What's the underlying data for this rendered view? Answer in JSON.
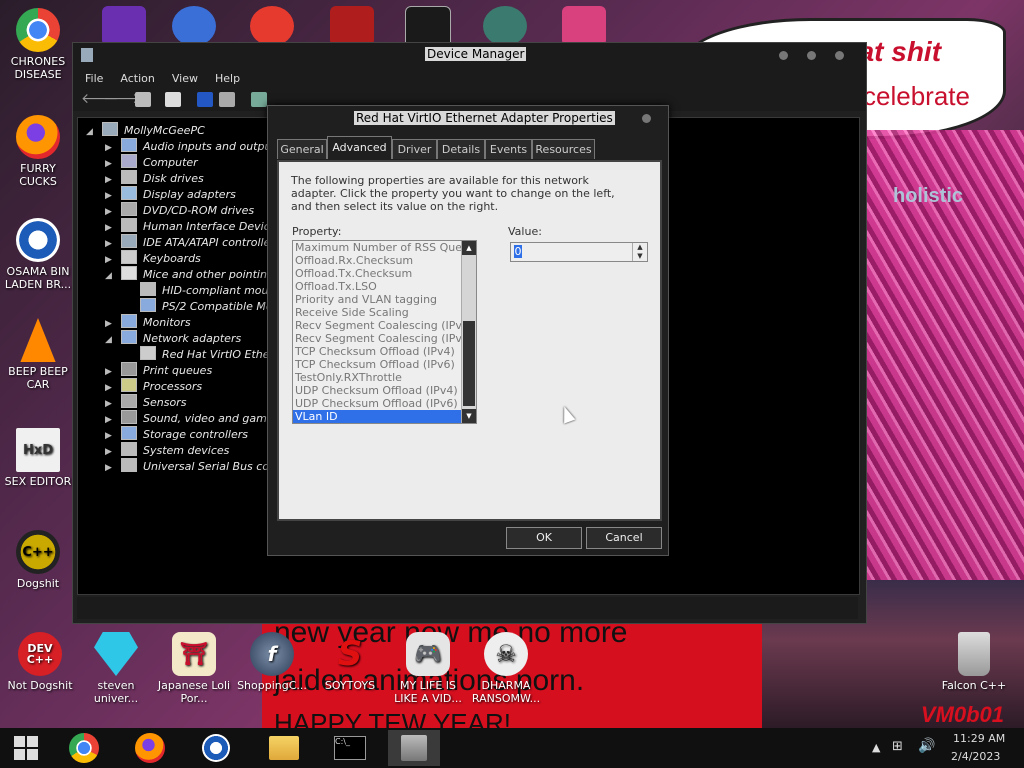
{
  "wallpaper": {
    "top_text_1": "eat shit",
    "top_text_2": "celebrate",
    "mid_text": "holistic",
    "red_lines": [
      "new year new me no more",
      "jaiden animations porn.",
      "HAPPY TEW YEAR!"
    ],
    "corner_tag": "VM0b01"
  },
  "desktop_icons": [
    {
      "label": "CHRONES DISEASE",
      "icon": "chrome-icon"
    },
    {
      "label": "FURRY CUCKS",
      "icon": "firefox-icon"
    },
    {
      "label": "OSAMA BIN LADEN BR...",
      "icon": "obama-logo-icon"
    },
    {
      "label": "BEEP BEEP CAR",
      "icon": "vlc-cone-icon"
    },
    {
      "label": "SEX EDITOR",
      "icon": "hxd-icon"
    },
    {
      "label": "Dogshit",
      "icon": "dogshit-icon"
    },
    {
      "label": "Not Dogshit",
      "icon": "devcpp-icon"
    },
    {
      "label": "steven univer...",
      "icon": "diamond-icon"
    },
    {
      "label": "Japanese Loli Por...",
      "icon": "torii-icon"
    },
    {
      "label": "ShoppingC...",
      "icon": "flash-icon"
    },
    {
      "label": "SOYTOYS",
      "icon": "soytoys-icon"
    },
    {
      "label": "MY LIFE IS LIKE A VID...",
      "icon": "gamepad-icon"
    },
    {
      "label": "DHARMA RANSOMW...",
      "icon": "skull-icon"
    },
    {
      "label": "Falcon C++",
      "icon": "trash-icon"
    }
  ],
  "device_manager": {
    "title": "Device Manager",
    "menu": [
      "File",
      "Action",
      "View",
      "Help"
    ],
    "tree": [
      {
        "label": "MollyMcGeePC",
        "level": 0,
        "expanded": true
      },
      {
        "label": "Audio inputs and outputs",
        "level": 1
      },
      {
        "label": "Computer",
        "level": 1
      },
      {
        "label": "Disk drives",
        "level": 1
      },
      {
        "label": "Display adapters",
        "level": 1
      },
      {
        "label": "DVD/CD-ROM drives",
        "level": 1
      },
      {
        "label": "Human Interface Devices",
        "level": 1
      },
      {
        "label": "IDE ATA/ATAPI controller:",
        "level": 1
      },
      {
        "label": "Keyboards",
        "level": 1
      },
      {
        "label": "Mice and other pointing de",
        "level": 1,
        "expanded": true
      },
      {
        "label": "HID-compliant mouse",
        "level": 2
      },
      {
        "label": "PS/2 Compatible Mou",
        "level": 2
      },
      {
        "label": "Monitors",
        "level": 1
      },
      {
        "label": "Network adapters",
        "level": 1,
        "expanded": true
      },
      {
        "label": "Red Hat VirtIO Ethern",
        "level": 2
      },
      {
        "label": "Print queues",
        "level": 1
      },
      {
        "label": "Processors",
        "level": 1
      },
      {
        "label": "Sensors",
        "level": 1
      },
      {
        "label": "Sound, video and game co",
        "level": 1
      },
      {
        "label": "Storage controllers",
        "level": 1
      },
      {
        "label": "System devices",
        "level": 1
      },
      {
        "label": "Universal Serial Bus contr",
        "level": 1
      }
    ]
  },
  "properties_dialog": {
    "title": "Red Hat VirtIO Ethernet Adapter Properties",
    "tabs": [
      "General",
      "Advanced",
      "Driver",
      "Details",
      "Events",
      "Resources"
    ],
    "active_tab": "Advanced",
    "description": "The following properties are available for this network adapter. Click the property you want to change on the left, and then select its value on the right.",
    "property_label": "Property:",
    "value_label": "Value:",
    "properties": [
      "Maximum Number of RSS Queues",
      "Offload.Rx.Checksum",
      "Offload.Tx.Checksum",
      "Offload.Tx.LSO",
      "Priority and VLAN tagging",
      "Receive Side Scaling",
      "Recv Segment Coalescing (IPv4)",
      "Recv Segment Coalescing (IPv6)",
      "TCP Checksum Offload (IPv4)",
      "TCP Checksum Offload (IPv6)",
      "TestOnly.RXThrottle",
      "UDP Checksum Offload (IPv4)",
      "UDP Checksum Offload (IPv6)",
      "VLan ID"
    ],
    "selected_property": "VLan ID",
    "value": "0",
    "ok_label": "OK",
    "cancel_label": "Cancel"
  },
  "taskbar": {
    "apps": [
      "start-icon",
      "chrome-icon",
      "firefox-icon",
      "obama-logo-icon",
      "file-explorer-icon",
      "cmd-icon",
      "device-manager-icon"
    ],
    "time": "11:29 AM",
    "date": "2/4/2023"
  }
}
